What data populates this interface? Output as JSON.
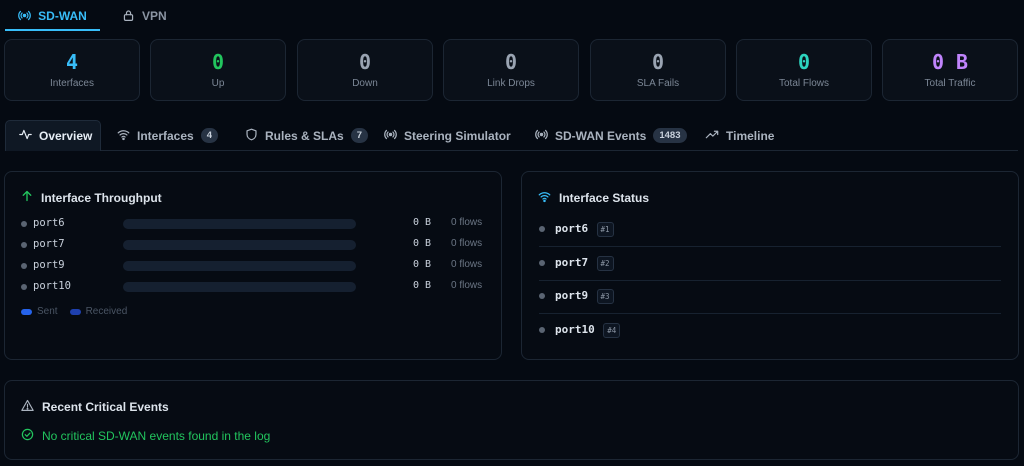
{
  "top_tabs": [
    {
      "label": "SD-WAN",
      "icon": "radio-signal-icon",
      "active": true
    },
    {
      "label": "VPN",
      "icon": "lock-icon",
      "active": false
    }
  ],
  "stats": [
    {
      "value": "4",
      "label": "Interfaces",
      "color": "#38bdf8"
    },
    {
      "value": "0",
      "label": "Up",
      "color": "#22c55e"
    },
    {
      "value": "0",
      "label": "Down",
      "color": "#9aa4b2"
    },
    {
      "value": "0",
      "label": "Link Drops",
      "color": "#9aa4b2"
    },
    {
      "value": "0",
      "label": "SLA Fails",
      "color": "#9aa4b2"
    },
    {
      "value": "0",
      "label": "Total Flows",
      "color": "#2dd4bf"
    },
    {
      "value": "0 B",
      "label": "Total Traffic",
      "color": "#c084fc"
    }
  ],
  "sub_tabs": [
    {
      "label": "Overview",
      "badge": "",
      "icon": "activity-icon"
    },
    {
      "label": "Interfaces",
      "badge": "4",
      "icon": "wifi-icon"
    },
    {
      "label": "Rules & SLAs",
      "badge": "7",
      "icon": "shield-icon"
    },
    {
      "label": "Steering Simulator",
      "badge": "",
      "icon": "radio-signal-icon"
    },
    {
      "label": "SD-WAN Events",
      "badge": "1483",
      "icon": "radio-signal-icon"
    },
    {
      "label": "Timeline",
      "badge": "",
      "icon": "trend-icon"
    }
  ],
  "throughput": {
    "title": "Interface Throughput",
    "rows": [
      {
        "name": "port6",
        "bytes": "0 B",
        "flows": "0 flows",
        "fill": 0
      },
      {
        "name": "port7",
        "bytes": "0 B",
        "flows": "0 flows",
        "fill": 0
      },
      {
        "name": "port9",
        "bytes": "0 B",
        "flows": "0 flows",
        "fill": 0
      },
      {
        "name": "port10",
        "bytes": "0 B",
        "flows": "0 flows",
        "fill": 0
      }
    ],
    "legend": {
      "sent": "Sent",
      "received": "Received",
      "sent_color": "#2563eb",
      "received_color": "#1e40af"
    }
  },
  "status": {
    "title": "Interface Status",
    "rows": [
      {
        "name": "port6",
        "num": "#1"
      },
      {
        "name": "port7",
        "num": "#2"
      },
      {
        "name": "port9",
        "num": "#3"
      },
      {
        "name": "port10",
        "num": "#4"
      }
    ]
  },
  "events": {
    "title": "Recent Critical Events",
    "message": "No critical SD-WAN events found in the log"
  },
  "colors": {
    "accent": "#38bdf8",
    "success": "#22c55e"
  }
}
